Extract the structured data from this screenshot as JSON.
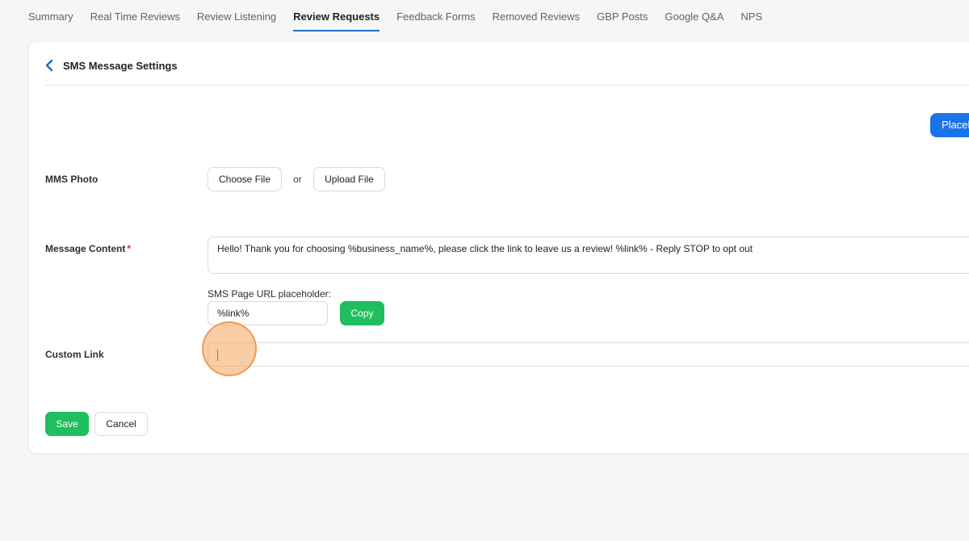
{
  "tabs": [
    {
      "label": "Summary"
    },
    {
      "label": "Real Time Reviews"
    },
    {
      "label": "Review Listening"
    },
    {
      "label": "Review Requests",
      "active": true
    },
    {
      "label": "Feedback Forms"
    },
    {
      "label": "Removed Reviews"
    },
    {
      "label": "GBP Posts"
    },
    {
      "label": "Google Q&A"
    },
    {
      "label": "NPS"
    }
  ],
  "header": {
    "title": "SMS Message Settings",
    "back_icon": "chevron-left-icon"
  },
  "placeholders_button": {
    "label": "Placeh"
  },
  "mms_photo": {
    "label": "MMS Photo",
    "choose_file": "Choose File",
    "or_text": "or",
    "upload_file": "Upload File"
  },
  "message_content": {
    "label": "Message Content",
    "required_mark": "*",
    "value": "Hello! Thank you for choosing %business_name%, please click the link to leave us a review! %link% - Reply STOP to opt out"
  },
  "sms_url": {
    "label": "SMS Page URL placeholder:",
    "value": "%link%",
    "copy": "Copy"
  },
  "custom_link": {
    "label": "Custom Link",
    "value": ""
  },
  "actions": {
    "save": "Save",
    "cancel": "Cancel"
  },
  "colors": {
    "accent_blue": "#1a73e8",
    "success_green": "#1fbe5f",
    "required_red": "#d93025",
    "click_marker": "#f5a65a"
  }
}
